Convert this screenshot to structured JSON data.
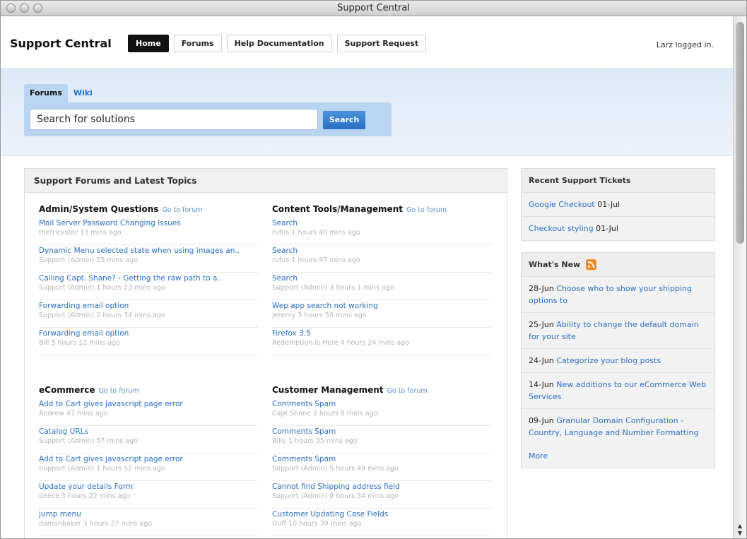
{
  "window": {
    "title": "Support Central"
  },
  "header": {
    "brand": "Support Central",
    "nav": [
      "Home",
      "Forums",
      "Help Documentation",
      "Support Request"
    ],
    "logged_in": "Larz logged in."
  },
  "search": {
    "tabs": [
      "Forums",
      "Wiki"
    ],
    "placeholder": "Search for solutions",
    "button": "Search"
  },
  "forums_panel": {
    "title": "Support Forums and Latest Topics",
    "goto_label": "Go to forum",
    "forums": [
      {
        "name": "Admin/System Questions",
        "topics": [
          {
            "title": "Mail Server Password Changing Issues",
            "meta": "thetrickster 13 mins ago"
          },
          {
            "title": "Dynamic Menu selected state when using images an..",
            "meta": "Support (Admin) 25 mins ago"
          },
          {
            "title": "Calling Capt. Shane? - Getting the raw path to a..",
            "meta": "Support (Admin) 1 hours 23 mins ago"
          },
          {
            "title": "Forwarding email option",
            "meta": "Support (Admin) 2 hours 34 mins ago"
          },
          {
            "title": "Forwarding email option",
            "meta": "Bill 5 hours 12 mins ago"
          }
        ]
      },
      {
        "name": "Content Tools/Management",
        "topics": [
          {
            "title": "Search",
            "meta": "rufus 1 hours 40 mins ago"
          },
          {
            "title": "Search",
            "meta": "rufus 1 hours 47 mins ago"
          },
          {
            "title": "Search",
            "meta": "Support (Admin) 3 hours 1 mins ago"
          },
          {
            "title": "Wep app search not working",
            "meta": "Jeremy 3 hours 50 mins ago"
          },
          {
            "title": "Firefox 3.5",
            "meta": "Redemption.is Here 4 hours 24 mins ago"
          }
        ]
      },
      {
        "name": "eCommerce",
        "topics": [
          {
            "title": "Add to Cart gives javascript page error",
            "meta": "Andrew 47 mins ago"
          },
          {
            "title": "Catalog URLs",
            "meta": "Support (Admin) 57 mins ago"
          },
          {
            "title": "Add to Cart gives javascript page error",
            "meta": "Support (Admin) 1 hours 52 mins ago"
          },
          {
            "title": "Update your details Form",
            "meta": "deece 3 hours 22 mins ago"
          },
          {
            "title": "jump menu",
            "meta": "damonbaker 3 hours 27 mins ago"
          }
        ]
      },
      {
        "name": "Customer Management",
        "topics": [
          {
            "title": "Comments Spam",
            "meta": "Capt Shane 1 hours 8 mins ago"
          },
          {
            "title": "Comments Spam",
            "meta": "Billy 1 hours 35 mins ago"
          },
          {
            "title": "Comments Spam",
            "meta": "Support (Admin) 5 hours 49 mins ago"
          },
          {
            "title": "Cannot find Shipping address field",
            "meta": "Support (Admin) 8 hours 34 mins ago"
          },
          {
            "title": "Customer Updating Case Fields",
            "meta": "Duff 10 hours 39 mins ago"
          }
        ]
      }
    ]
  },
  "tickets": {
    "title": "Recent Support Tickets",
    "items": [
      {
        "link": "Google Checkout",
        "date": "01-Jul"
      },
      {
        "link": "Checkout styling",
        "date": "01-Jul"
      }
    ]
  },
  "whats_new": {
    "title": "What's New",
    "items": [
      {
        "date": "28-Jun",
        "link": "Choose who to show your shipping options to"
      },
      {
        "date": "25-Jun",
        "link": "Ability to change the default domain for your site"
      },
      {
        "date": "24-Jun",
        "link": "Categorize your blog posts"
      },
      {
        "date": "14-Jun",
        "link": "New additions to our eCommerce Web Services"
      },
      {
        "date": "09-Jun",
        "link": "Granular Domain Configuration - Country, Language and Number Formatting"
      }
    ],
    "more": "More"
  },
  "icons": [
    "close-window-icon",
    "minimize-window-icon",
    "zoom-window-icon",
    "rss-icon",
    "scroll-up-arrow-icon",
    "scroll-down-arrow-icon"
  ]
}
